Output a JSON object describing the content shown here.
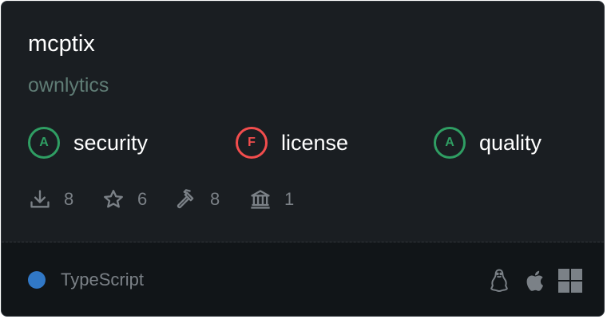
{
  "package": {
    "name": "mcptix",
    "owner": "ownlytics"
  },
  "scores": [
    {
      "grade": "A",
      "label": "security"
    },
    {
      "grade": "F",
      "label": "license"
    },
    {
      "grade": "A",
      "label": "quality"
    }
  ],
  "stats": {
    "downloads": "8",
    "stars": "6",
    "tools": "8",
    "registries": "1"
  },
  "footer": {
    "language": "TypeScript",
    "language_color": "#3178c6",
    "platforms": [
      "linux-icon",
      "apple-icon",
      "windows-icon"
    ]
  },
  "colors": {
    "grade_good": "#2f9e63",
    "grade_bad": "#f24d4d"
  }
}
